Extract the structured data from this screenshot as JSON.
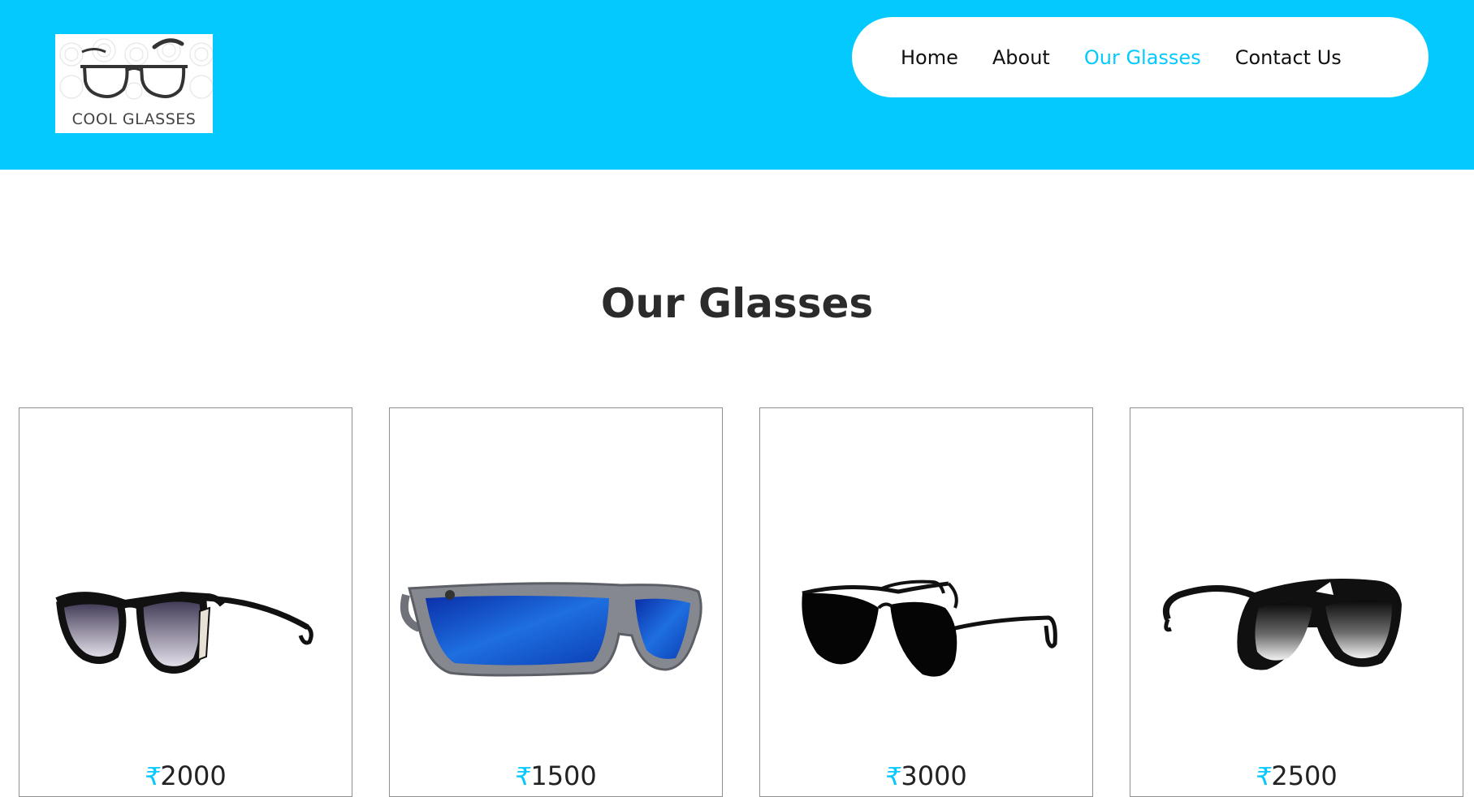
{
  "brand": {
    "logo_text": "COOL GLASSES",
    "accent_color": "#04c9ff"
  },
  "nav": {
    "items": [
      {
        "label": "Home",
        "active": false
      },
      {
        "label": "About",
        "active": false
      },
      {
        "label": "Our Glasses",
        "active": true
      },
      {
        "label": "Contact Us",
        "active": false
      }
    ]
  },
  "section": {
    "title": "Our Glasses"
  },
  "products": [
    {
      "currency": "₹",
      "price": "2000",
      "image": "cat-eye-sunglasses-icon"
    },
    {
      "currency": "₹",
      "price": "1500",
      "image": "blue-mirror-sunglasses-icon"
    },
    {
      "currency": "₹",
      "price": "3000",
      "image": "aviator-sunglasses-icon"
    },
    {
      "currency": "₹",
      "price": "2500",
      "image": "shield-sunglasses-icon"
    }
  ]
}
